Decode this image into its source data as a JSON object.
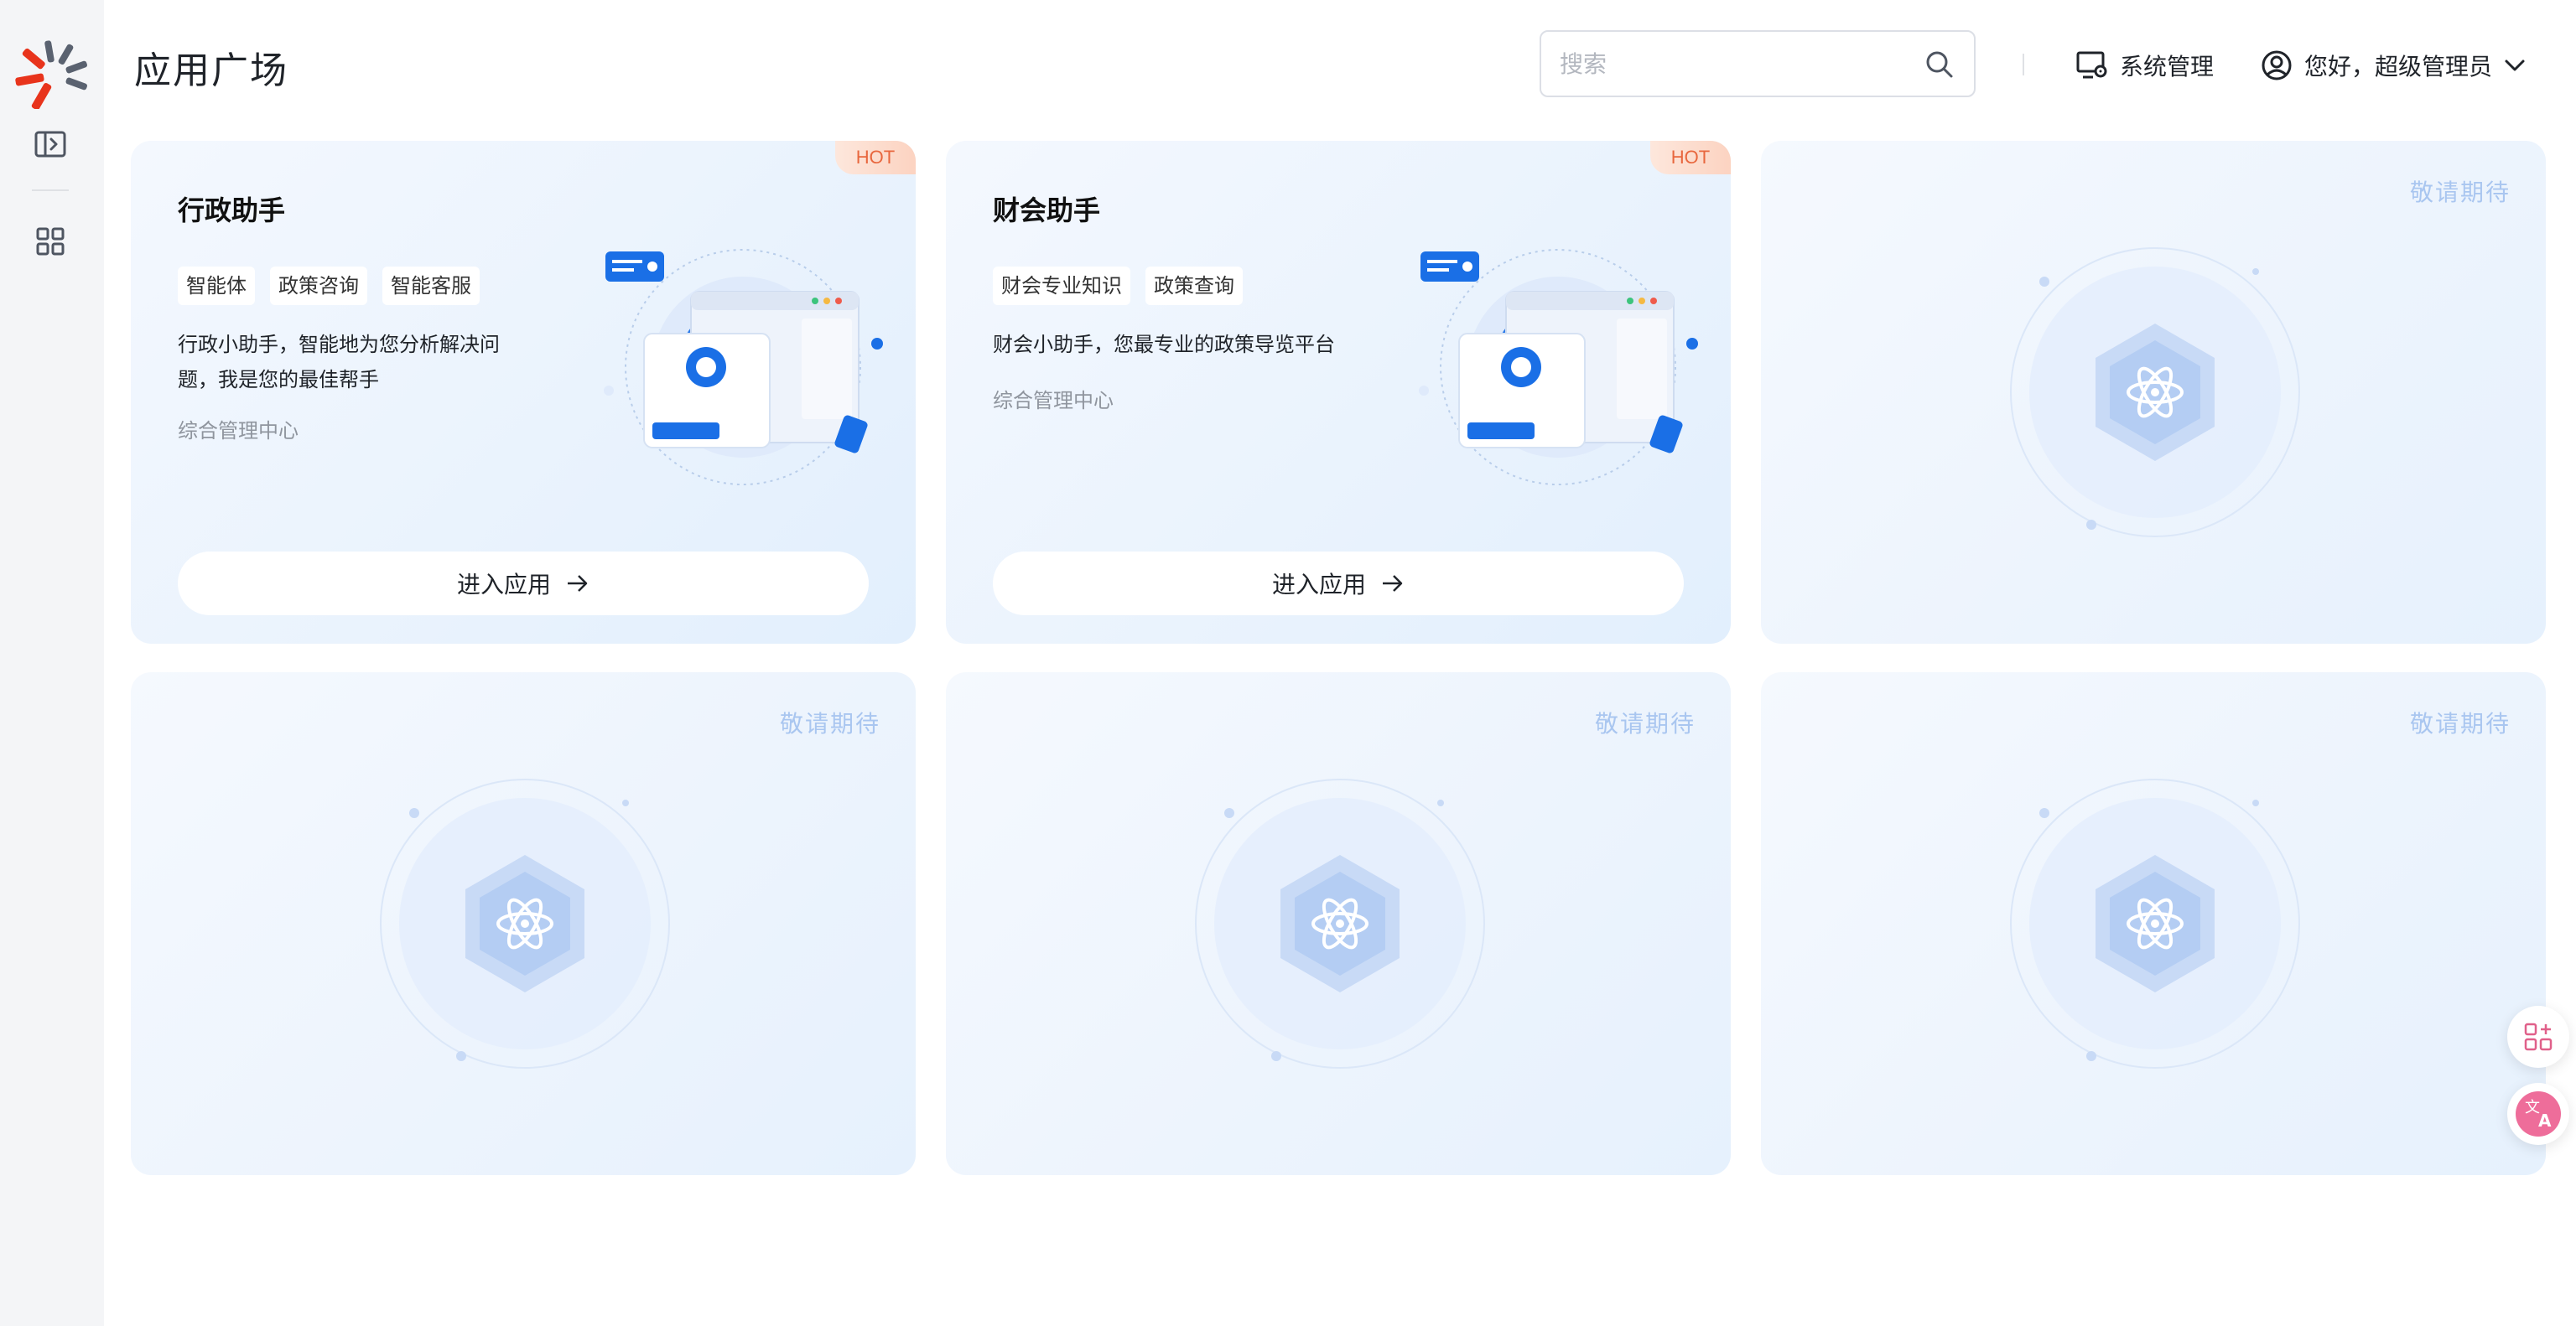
{
  "header": {
    "title": "应用广场",
    "search_placeholder": "搜索",
    "system_label": "系统管理",
    "user_label": "您好，超级管理员"
  },
  "apps": [
    {
      "title": "行政助手",
      "badge": "HOT",
      "tags": [
        "智能体",
        "政策咨询",
        "智能客服"
      ],
      "desc": "行政小助手，智能地为您分析解决问题，我是您的最佳帮手",
      "dept": "综合管理中心",
      "button": "进入应用"
    },
    {
      "title": "财会助手",
      "badge": "HOT",
      "tags": [
        "财会专业知识",
        "政策查询"
      ],
      "desc": "财会小助手，您最专业的政策导览平台",
      "dept": "综合管理中心",
      "button": "进入应用"
    }
  ],
  "placeholders": [
    "敬请期待",
    "敬请期待",
    "敬请期待",
    "敬请期待"
  ],
  "colors": {
    "accent": "#1a6fe6",
    "hot": "#e8673e",
    "coming_soon": "#a9c6f0"
  },
  "icons": {
    "sidebar": [
      "logo",
      "sidebar-toggle-icon",
      "apps-grid-icon"
    ],
    "header": [
      "search-icon",
      "system-settings-icon",
      "user-icon",
      "chevron-down-icon"
    ],
    "floating": [
      "add-app-icon",
      "translate-icon"
    ]
  }
}
